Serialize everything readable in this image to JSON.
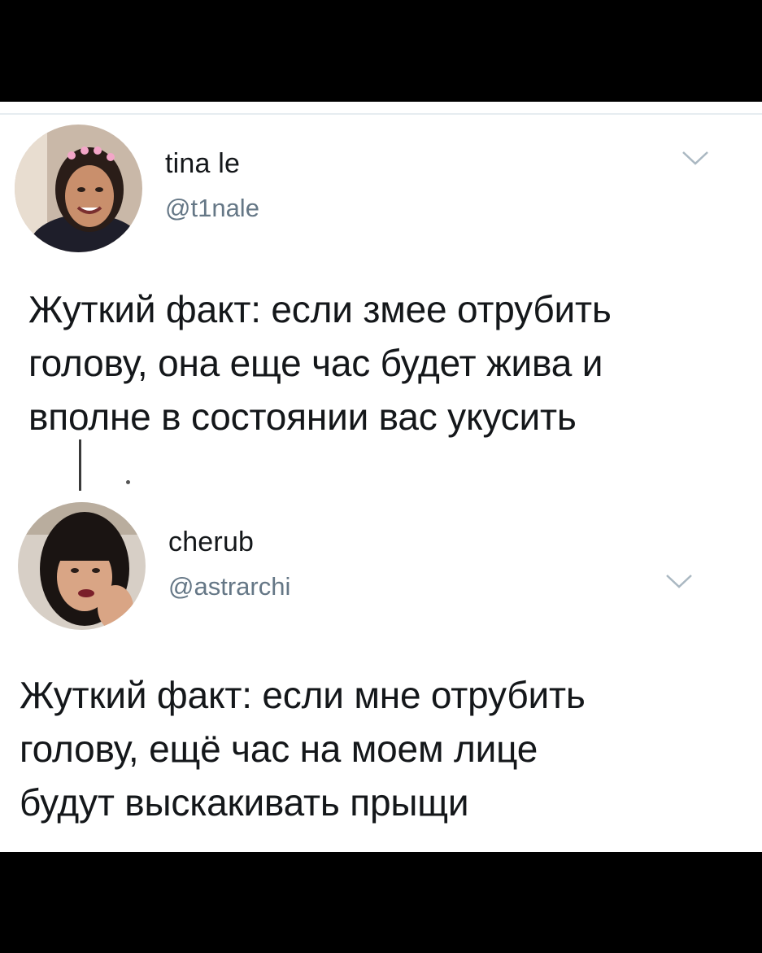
{
  "tweets": [
    {
      "display_name": "tina le",
      "handle": "@t1nale",
      "text": "Жуткий факт: если змее отрубить\nголову, она еще час будет жива и\nвполне в состоянии вас укусить",
      "menu_icon": "chevron-down-icon",
      "avatar_icon": "avatar"
    },
    {
      "display_name": "cherub",
      "handle": "@astrarchi",
      "text": "Жуткий факт: если мне отрубить\nголову, ещё час на моем лице\nбудут выскакивать прыщи",
      "menu_icon": "chevron-down-icon",
      "avatar_icon": "avatar"
    }
  ],
  "colors": {
    "background": "#000000",
    "card": "#ffffff",
    "name": "#14171a",
    "handle": "#657786",
    "chevron": "#aab8c2"
  }
}
